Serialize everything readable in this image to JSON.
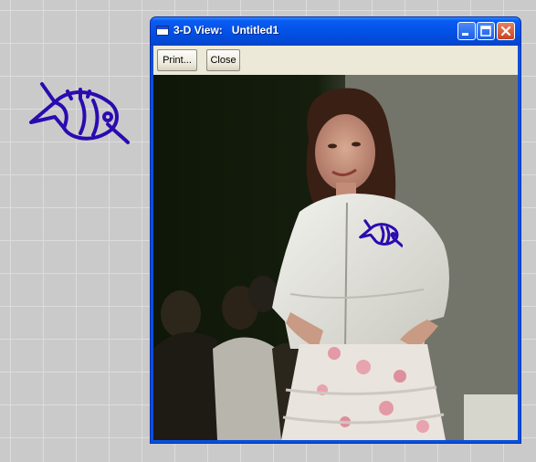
{
  "desktop": {
    "sticker_icon": "fish-icon"
  },
  "window": {
    "title": "3-D View:   Untitled1",
    "controls": [
      "minimize-icon",
      "maximize-icon",
      "close-icon"
    ],
    "toolbar": {
      "print_label": "Print...",
      "close_label": "Close"
    },
    "viewport": {
      "content": "3D preview photo",
      "overlay_icon": "fish-icon"
    },
    "colors": {
      "titlebar": "#0a5cf3",
      "frame": "#0a4fdc",
      "toolbar": "#ece9d8",
      "fish": "#2a0bb0"
    }
  }
}
